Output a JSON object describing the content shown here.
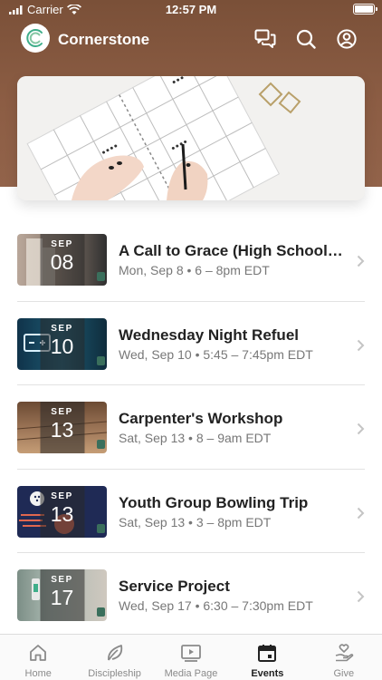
{
  "status_bar": {
    "carrier": "Carrier",
    "time": "12:57 PM"
  },
  "app": {
    "title": "Cornerstone"
  },
  "colors": {
    "header": "#8c5d44",
    "tab_active": "#222222",
    "tab_inactive": "#8a8a8a"
  },
  "events": [
    {
      "title": "A Call to Grace (High School S...",
      "subtitle": "Mon, Sep 8 • 6 – 8pm EDT",
      "month": "SEP",
      "day": "08"
    },
    {
      "title": "Wednesday Night Refuel",
      "subtitle": "Wed, Sep 10 • 5:45 – 7:45pm EDT",
      "month": "SEP",
      "day": "10"
    },
    {
      "title": "Carpenter's Workshop",
      "subtitle": "Sat, Sep 13 • 8 – 9am EDT",
      "month": "SEP",
      "day": "13"
    },
    {
      "title": "Youth Group Bowling Trip",
      "subtitle": "Sat, Sep 13 • 3 – 8pm EDT",
      "month": "SEP",
      "day": "13"
    },
    {
      "title": "Service Project",
      "subtitle": "Wed, Sep 17 • 6:30 – 7:30pm EDT",
      "month": "SEP",
      "day": "17"
    }
  ],
  "tabs": [
    {
      "label": "Home",
      "icon": "home-icon"
    },
    {
      "label": "Discipleship",
      "icon": "leaf-icon"
    },
    {
      "label": "Media Page",
      "icon": "video-icon"
    },
    {
      "label": "Events",
      "icon": "calendar-icon",
      "active": true
    },
    {
      "label": "Give",
      "icon": "heart-hand-icon"
    }
  ]
}
